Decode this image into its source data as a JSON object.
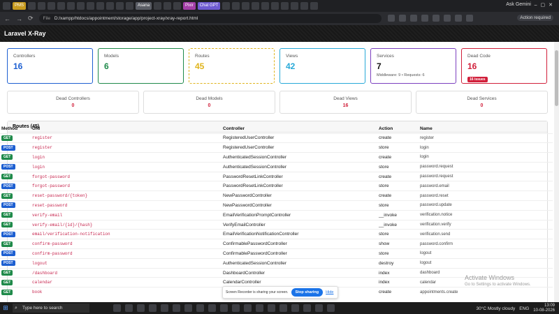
{
  "browser": {
    "tabs": [
      "PMS",
      "Asana",
      "Pixir",
      "Chat GPT"
    ],
    "ask_gemini": "Ask Gemini",
    "url_scheme": "File",
    "url": "D:/xampp/htdocs/appointment/storage/app/project-xray/xray-report.html",
    "action_required": "Action required"
  },
  "app": {
    "title": "Laravel X-Ray"
  },
  "stats": [
    {
      "label": "Controllers",
      "value": "16"
    },
    {
      "label": "Models",
      "value": "6"
    },
    {
      "label": "Routes",
      "value": "45"
    },
    {
      "label": "Views",
      "value": "42"
    },
    {
      "label": "Services",
      "value": "7",
      "sub": "Middleware: 9 • Requests: 6"
    },
    {
      "label": "Dead Code",
      "value": "16",
      "badge": "16 issues"
    }
  ],
  "dead": [
    {
      "label": "Dead Controllers",
      "value": "0"
    },
    {
      "label": "Dead Models",
      "value": "0"
    },
    {
      "label": "Dead Views",
      "value": "16"
    },
    {
      "label": "Dead Services",
      "value": "0"
    }
  ],
  "routes": {
    "title": "Routes (45)",
    "headers": [
      "Method",
      "URI",
      "Controller",
      "Action",
      "Name"
    ],
    "rows": [
      {
        "method": "GET",
        "uri": "register",
        "controller": "RegisteredUserController",
        "action": "create",
        "name": "register"
      },
      {
        "method": "POST",
        "uri": "register",
        "controller": "RegisteredUserController",
        "action": "store",
        "name": "login"
      },
      {
        "method": "GET",
        "uri": "login",
        "controller": "AuthenticatedSessionController",
        "action": "create",
        "name": "login"
      },
      {
        "method": "POST",
        "uri": "login",
        "controller": "AuthenticatedSessionController",
        "action": "store",
        "name": "password.request"
      },
      {
        "method": "GET",
        "uri": "forgot-password",
        "controller": "PasswordResetLinkController",
        "action": "create",
        "name": "password.request"
      },
      {
        "method": "POST",
        "uri": "forgot-password",
        "controller": "PasswordResetLinkController",
        "action": "store",
        "name": "password.email"
      },
      {
        "method": "GET",
        "uri": "reset-password/{token}",
        "controller": "NewPasswordController",
        "action": "create",
        "name": "password.reset"
      },
      {
        "method": "POST",
        "uri": "reset-password",
        "controller": "NewPasswordController",
        "action": "store",
        "name": "password.update"
      },
      {
        "method": "GET",
        "uri": "verify-email",
        "controller": "EmailVerificationPromptController",
        "action": "__invoke",
        "name": "verification.notice"
      },
      {
        "method": "GET",
        "uri": "verify-email/{id}/{hash}",
        "controller": "VerifyEmailController",
        "action": "__invoke",
        "name": "verification.verify"
      },
      {
        "method": "POST",
        "uri": "email/verification-notification",
        "controller": "EmailVerificationNotificationController",
        "action": "store",
        "name": "verification.send"
      },
      {
        "method": "GET",
        "uri": "confirm-password",
        "controller": "ConfirmablePasswordController",
        "action": "show",
        "name": "password.confirm"
      },
      {
        "method": "POST",
        "uri": "confirm-password",
        "controller": "ConfirmablePasswordController",
        "action": "store",
        "name": "logout"
      },
      {
        "method": "POST",
        "uri": "logout",
        "controller": "AuthenticatedSessionController",
        "action": "destroy",
        "name": "logout"
      },
      {
        "method": "GET",
        "uri": "/dashboard",
        "controller": "DashboardController",
        "action": "index",
        "name": "dashboard"
      },
      {
        "method": "GET",
        "uri": "calendar",
        "controller": "CalendarController",
        "action": "index",
        "name": "calendar"
      },
      {
        "method": "GET",
        "uri": "book",
        "controller": "AppointmentController",
        "action": "create",
        "name": "appointments.create"
      }
    ]
  },
  "share": {
    "text": "Screen Recorder is sharing your screen.",
    "stop": "Stop sharing",
    "hide": "Hide"
  },
  "watermark": {
    "line1": "Activate Windows",
    "line2": "Go to Settings to activate Windows."
  },
  "taskbar": {
    "search": "Type here to search",
    "weather": "30°C  Mostly cloudy",
    "lang": "ENG",
    "time": "13:09",
    "date": "10-08-2026"
  }
}
